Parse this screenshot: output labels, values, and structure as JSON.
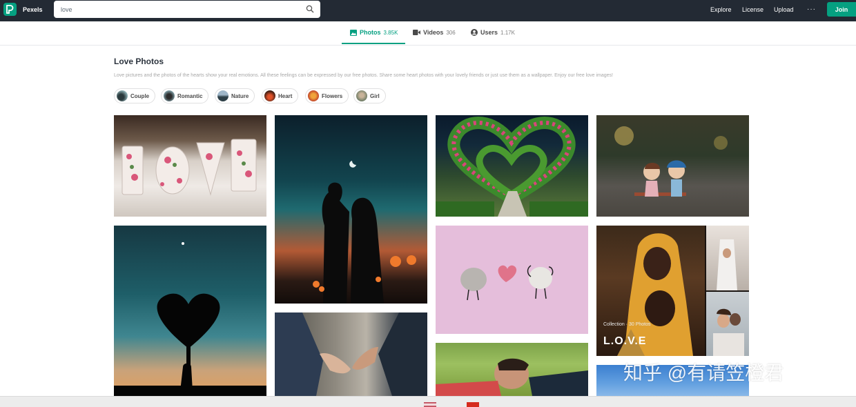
{
  "navbar": {
    "brand": "Pexels",
    "search_value": "love",
    "links": [
      "Explore",
      "License",
      "Upload"
    ],
    "more": "···",
    "join": "Join"
  },
  "tabs": [
    {
      "label": "Photos",
      "count": "3.85K",
      "icon": "image-icon",
      "active": true
    },
    {
      "label": "Videos",
      "count": "306",
      "icon": "video-icon",
      "active": false
    },
    {
      "label": "Users",
      "count": "1.17K",
      "icon": "user-icon",
      "active": false
    }
  ],
  "header": {
    "title": "Love Photos",
    "description": "Love pictures and the photos of the hearts show your real emotions. All these feelings can be expressed by our free photos. Share some heart photos with your lovely friends or just use them as a wallpaper. Enjoy our free love images!"
  },
  "chips": [
    "Couple",
    "Romantic",
    "Nature",
    "Heart",
    "Flowers",
    "Girl"
  ],
  "collection": {
    "subtitle": "Collection · 30 Photos",
    "title": "L.O.V.E"
  },
  "watermark": "知乎 @有请笠橙君",
  "colors": {
    "accent": "#05a081",
    "navbar": "#232a34"
  }
}
